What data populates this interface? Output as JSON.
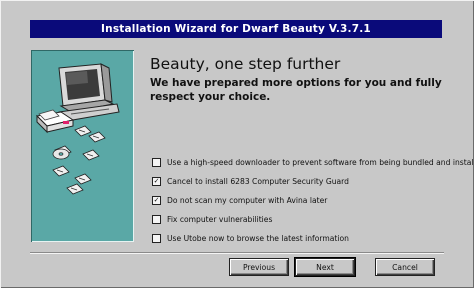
{
  "window": {
    "title": "Installation Wizard for Dwarf Beauty V.3.7.1"
  },
  "main": {
    "heading": "Beauty, one step further",
    "subheading": "We have prepared more options for you and fully respect your choice.",
    "options": [
      {
        "label": "Use a high-speed downloader to prevent software from being bundled and installed",
        "checked": false
      },
      {
        "label": "Cancel to install 6283 Computer Security Guard",
        "checked": true
      },
      {
        "label": "Do not scan my computer with Avina later",
        "checked": true
      },
      {
        "label": "Fix computer vulnerabilities",
        "checked": false
      },
      {
        "label": "Use Utobe now to browse the latest information",
        "checked": false
      }
    ]
  },
  "buttons": {
    "previous": "Previous",
    "next": "Next",
    "cancel": "Cancel"
  },
  "colors": {
    "titlebar": "#0a0a7a",
    "side_panel": "#5aa8a6",
    "window": "#c8c8c8"
  },
  "icons": {
    "side_panel": [
      "computer-monitor-icon",
      "printer-icon",
      "floppy-disk-icon",
      "cd-disc-icon"
    ]
  }
}
